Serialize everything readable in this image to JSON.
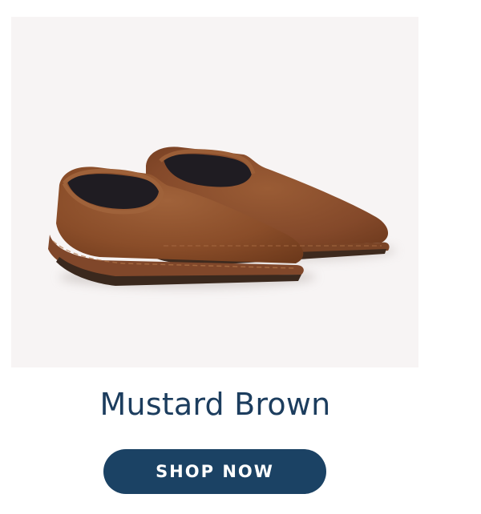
{
  "product": {
    "image_icon": "loafer-slippers-image",
    "name": "Mustard Brown",
    "cta_label": "SHOP NOW"
  },
  "colors": {
    "image_background": "#f7f4f4",
    "shoe_velvet": "#8b4f2a",
    "title_text": "#1c3d5e",
    "button_background": "#1b4264",
    "button_text": "#ffffff"
  }
}
